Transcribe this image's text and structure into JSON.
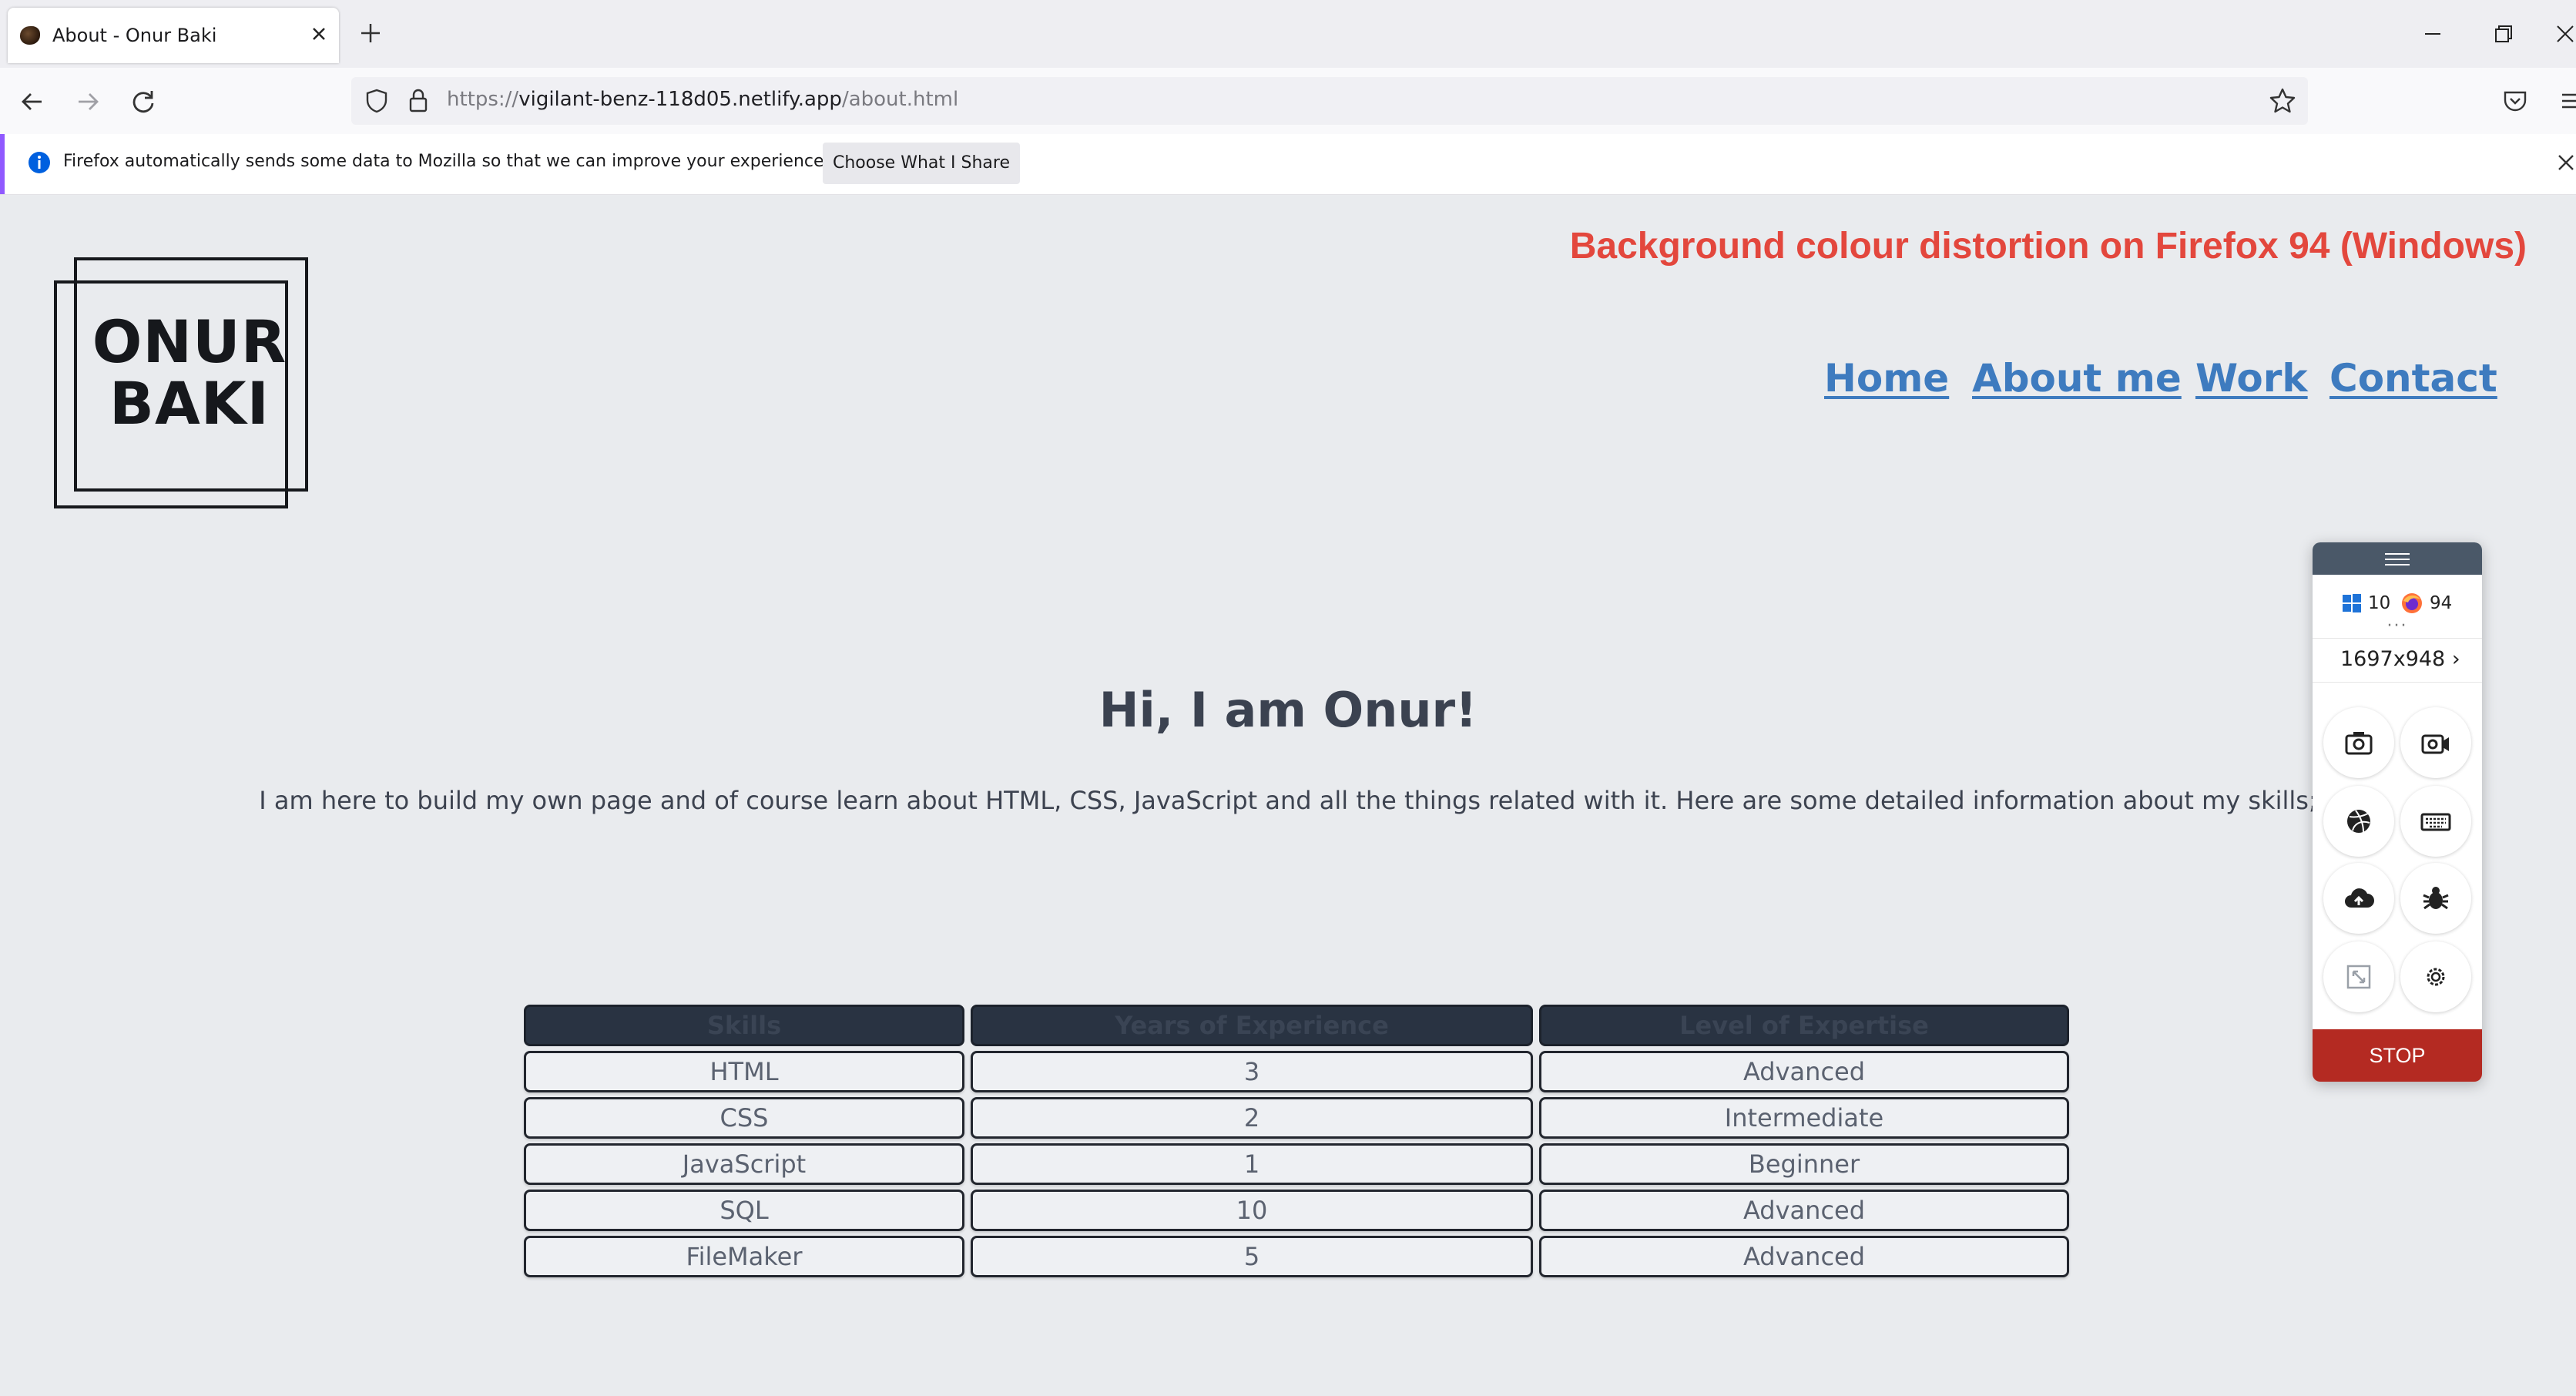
{
  "browser": {
    "tab_title": "About - Onur Baki",
    "url_prefix": "https://",
    "url_domain": "vigilant-benz-118d05.netlify.app",
    "url_path": "/about.html",
    "notification": {
      "text": "Firefox automatically sends some data to Mozilla so that we can improve your experience.",
      "button_label": "Choose What I Share"
    }
  },
  "annotation": "Background colour distortion on Firefox 94 (Windows)",
  "page": {
    "logo_line1": "ONUR",
    "logo_line2": "BAKI",
    "nav": [
      "Home",
      "About me",
      "Work",
      "Contact"
    ],
    "heading": "Hi, I am Onur!",
    "intro": "I am here to build my own page and of course learn about HTML, CSS, JavaScript and all the things related with it. Here are some detailed information about my skills;",
    "skills_table": {
      "headers": [
        "Skills",
        "Years of Experience",
        "Level of Expertise"
      ],
      "rows": [
        [
          "HTML",
          "3",
          "Advanced"
        ],
        [
          "CSS",
          "2",
          "Intermediate"
        ],
        [
          "JavaScript",
          "1",
          "Beginner"
        ],
        [
          "SQL",
          "10",
          "Advanced"
        ],
        [
          "FileMaker",
          "5",
          "Advanced"
        ]
      ]
    }
  },
  "tool_panel": {
    "os_version": "10",
    "browser_version": "94",
    "resolution": "1697x948",
    "stop_label": "STOP",
    "tools": [
      "camera-icon",
      "video-icon",
      "dribbble-icon",
      "keyboard-icon",
      "upload-icon",
      "bug-icon",
      "resize-icon",
      "gear-icon"
    ]
  },
  "colors": {
    "page_background": "#e9ebee",
    "nav_link": "#3e7bbf",
    "annotation": "#e3473d",
    "stop_button": "#b42a22",
    "table_header": "#293342"
  }
}
